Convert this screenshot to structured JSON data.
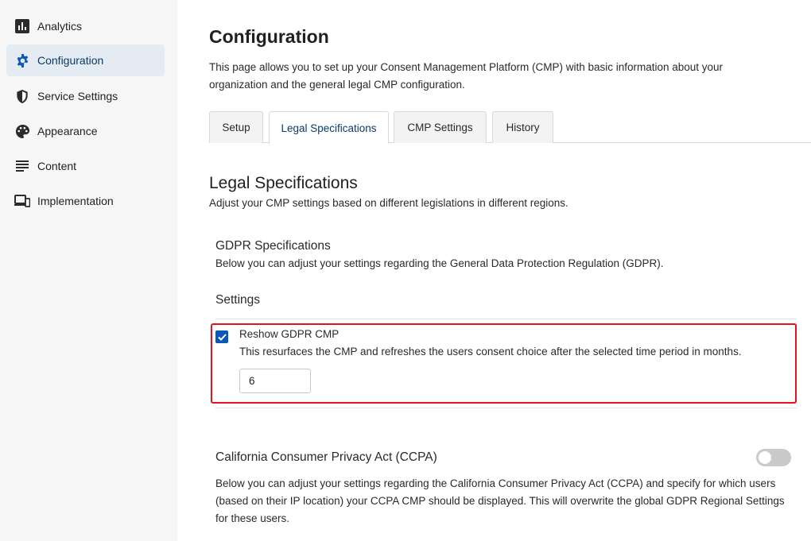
{
  "sidebar": {
    "items": [
      {
        "label": "Analytics",
        "icon": "bar-chart-icon"
      },
      {
        "label": "Configuration",
        "icon": "gear-icon",
        "active": true
      },
      {
        "label": "Service Settings",
        "icon": "shield-icon"
      },
      {
        "label": "Appearance",
        "icon": "palette-icon"
      },
      {
        "label": "Content",
        "icon": "text-lines-icon"
      },
      {
        "label": "Implementation",
        "icon": "devices-icon"
      }
    ]
  },
  "main": {
    "title": "Configuration",
    "description": "This page allows you to set up your Consent Management Platform (CMP) with basic information about your organization and the general legal CMP configuration.",
    "tabs": [
      {
        "label": "Setup"
      },
      {
        "label": "Legal Specifications",
        "active": true
      },
      {
        "label": "CMP Settings"
      },
      {
        "label": "History"
      }
    ],
    "section": {
      "title": "Legal Specifications",
      "description": "Adjust your CMP settings based on different legislations in different regions."
    },
    "gdpr": {
      "title": "GDPR Specifications",
      "description": "Below you can adjust your settings regarding the General Data Protection Regulation (GDPR).",
      "settings_title": "Settings",
      "reshow": {
        "label": "Reshow GDPR CMP",
        "checked": true,
        "description": "This resurfaces the CMP and refreshes the users consent choice after the selected time period in months.",
        "value": "6"
      }
    },
    "ccpa": {
      "title": "California Consumer Privacy Act (CCPA)",
      "enabled": false,
      "description": "Below you can adjust your settings regarding the California Consumer Privacy Act (CCPA) and specify for which users (based on their IP location) your CCPA CMP should be displayed. This will overwrite the global GDPR Regional Settings for these users."
    }
  },
  "colors": {
    "accent": "#0b57b8",
    "active_nav_bg": "#e4ebf3",
    "highlight_border": "#e3121c",
    "toggle_off": "#c9c9c9"
  }
}
